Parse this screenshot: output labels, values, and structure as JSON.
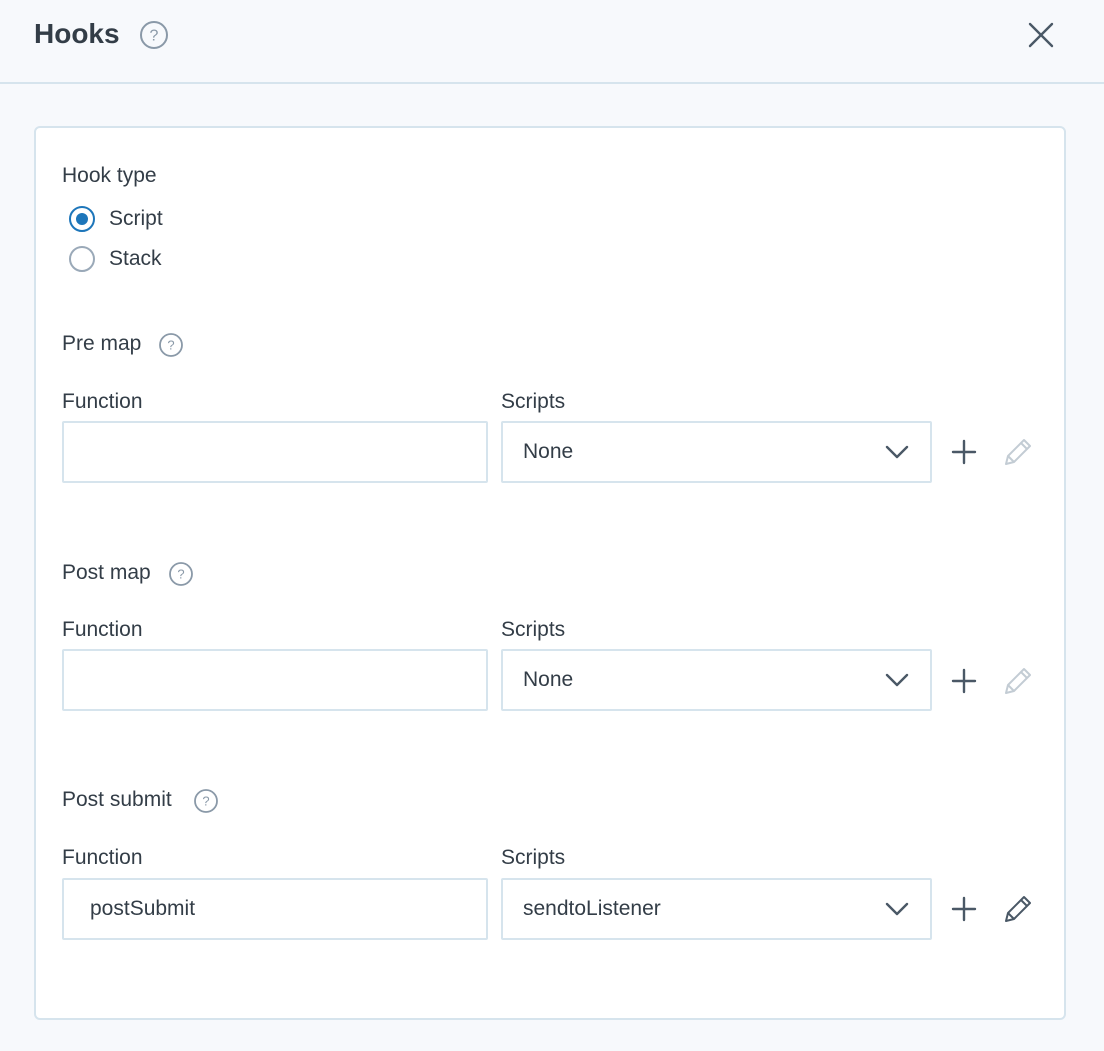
{
  "header": {
    "title": "Hooks",
    "help_icon": "question-circle-icon",
    "close_icon": "close-icon"
  },
  "hook_type": {
    "label": "Hook type",
    "options": [
      {
        "label": "Script",
        "checked": true
      },
      {
        "label": "Stack",
        "checked": false
      }
    ]
  },
  "sections": [
    {
      "title": "Pre map",
      "function_label": "Function",
      "function_value": "",
      "scripts_label": "Scripts",
      "scripts_value": "None",
      "edit_enabled": false
    },
    {
      "title": "Post map",
      "function_label": "Function",
      "function_value": "",
      "scripts_label": "Scripts",
      "scripts_value": "None",
      "edit_enabled": false
    },
    {
      "title": "Post submit",
      "function_label": "Function",
      "function_value": "postSubmit",
      "scripts_label": "Scripts",
      "scripts_value": "sendtoListener",
      "edit_enabled": true
    }
  ],
  "colors": {
    "accent": "#1d76ba",
    "border": "#d6e4ed",
    "text": "#333d47",
    "icon_disabled": "#c3ccd4",
    "icon_enabled": "#4a5866"
  }
}
